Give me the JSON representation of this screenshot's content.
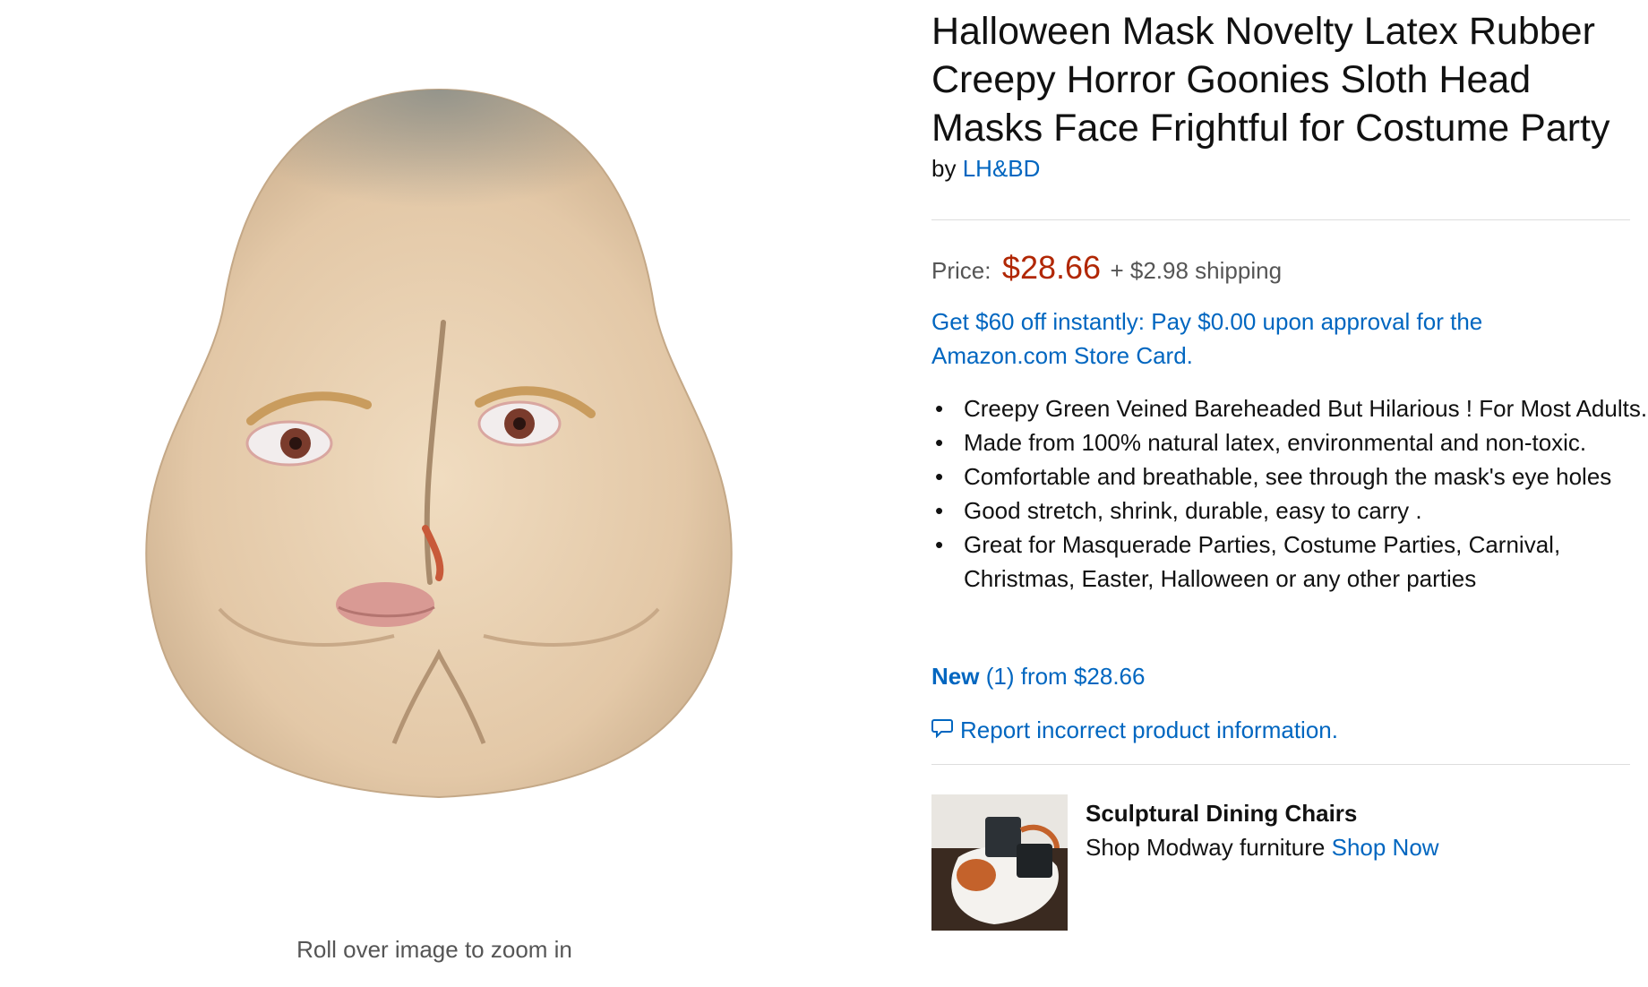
{
  "image": {
    "alt": "Latex mask shaped like buttocks with eyes, eyebrows and lips",
    "zoom_hint": "Roll over image to zoom in"
  },
  "product": {
    "title": "Halloween Mask Novelty Latex Rubber Creepy Horror Goonies Sloth Head Masks Face Frightful for Costume Party",
    "by_prefix": "by",
    "brand": "LH&BD",
    "price_label": "Price:",
    "price": "$28.66",
    "shipping": "+ $2.98 shipping",
    "promo": "Get $60 off instantly: Pay $0.00 upon approval for the Amazon.com Store Card.",
    "bullets": [
      "Creepy Green Veined Bareheaded But Hilarious ! For Most Adults.",
      "Made from 100% natural latex, environmental and non-toxic.",
      "Comfortable and breathable, see through the mask's eye holes",
      "Good stretch, shrink, durable, easy to carry .",
      "Great for Masquerade Parties, Costume Parties, Carnival, Christmas, Easter, Halloween or any other parties"
    ],
    "offers": {
      "new_label": "New",
      "count": "(1)",
      "from_text": "from $28.66"
    },
    "report": "Report incorrect product information."
  },
  "ad": {
    "title": "Sculptural Dining Chairs",
    "text": "Shop Modway furniture",
    "cta": "Shop Now"
  },
  "colors": {
    "link": "#0066c0",
    "price": "#b12704",
    "divider": "#dddddd"
  }
}
